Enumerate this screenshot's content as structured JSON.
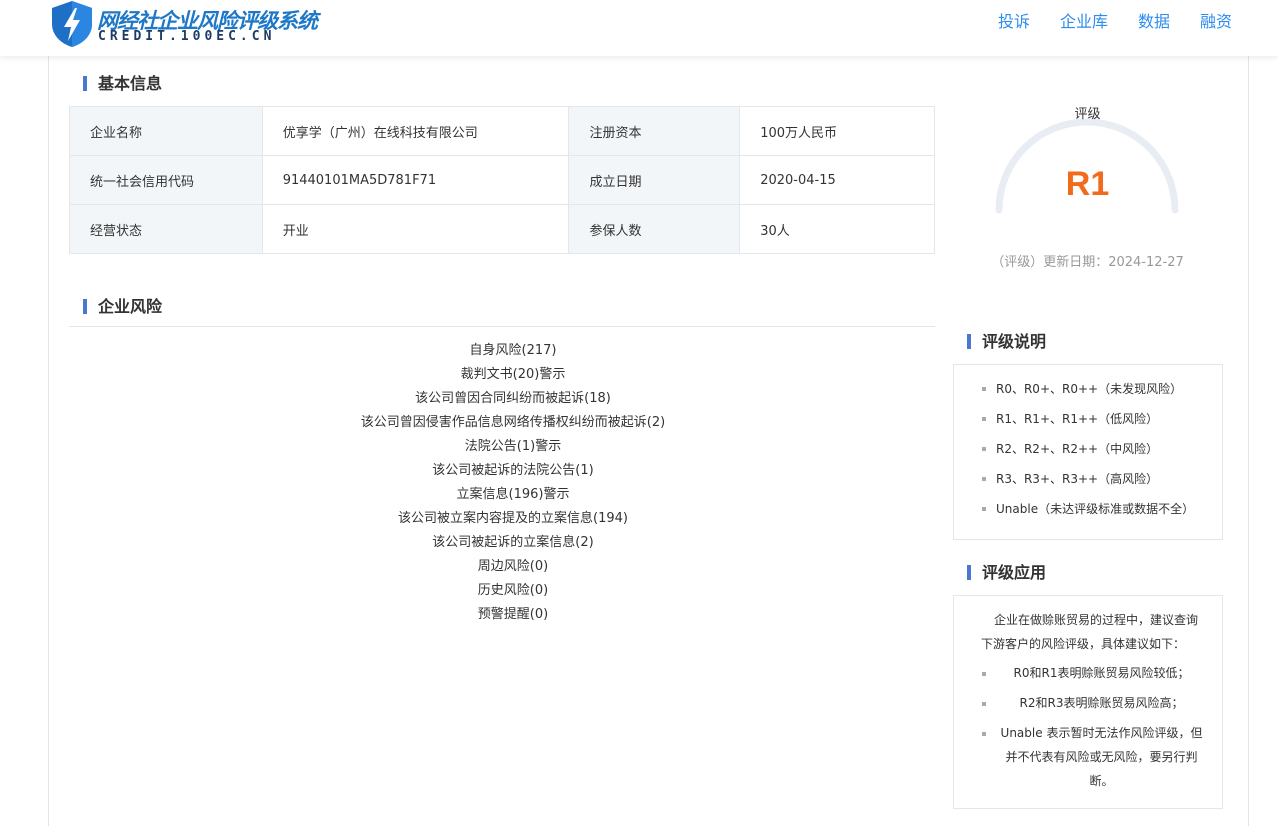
{
  "header": {
    "logo_title": "网经社企业风险评级系统",
    "logo_subtitle": "CREDIT.100EC.CN",
    "nav": [
      "投诉",
      "企业库",
      "数据",
      "融资"
    ]
  },
  "basic_info": {
    "title": "基本信息",
    "rows": [
      [
        "企业名称",
        "优享学（广州）在线科技有限公司",
        "注册资本",
        "100万人民币"
      ],
      [
        "统一社会信用代码",
        "91440101MA5D781F71",
        "成立日期",
        "2020-04-15"
      ],
      [
        "经营状态",
        "开业",
        "参保人数",
        "30人"
      ]
    ]
  },
  "rating": {
    "label": "评级",
    "value": "R1",
    "update_text": "（评级）更新日期：2024-12-27",
    "value_color": "#f26a1b"
  },
  "risk": {
    "title": "企业风险",
    "items": [
      "自身风险(217)",
      "裁判文书(20)警示",
      "该公司曾因合同纠纷而被起诉(18)",
      "该公司曾因侵害作品信息网络传播权纠纷而被起诉(2)",
      "法院公告(1)警示",
      "该公司被起诉的法院公告(1)",
      "立案信息(196)警示",
      "该公司被立案内容提及的立案信息(194)",
      "该公司被起诉的立案信息(2)",
      "周边风险(0)",
      "历史风险(0)",
      "预警提醒(0)"
    ]
  },
  "rating_explanation": {
    "title": "评级说明",
    "items": [
      "R0、R0+、R0++（未发现风险）",
      "R1、R1+、R1++（低风险）",
      "R2、R2+、R2++（中风险）",
      "R3、R3+、R3++（高风险）",
      "Unable（未达评级标准或数据不全）"
    ]
  },
  "rating_application": {
    "title": "评级应用",
    "intro": "企业在做赊账贸易的过程中，建议查询下游客户的风险评级，具体建议如下：",
    "items": [
      "R0和R1表明赊账贸易风险较低；",
      "R2和R3表明赊账贸易风险高；",
      "Unable 表示暂时无法作风险评级，但并不代表有风险或无风险，要另行判断。"
    ]
  },
  "colors": {
    "accent": "#2d8cf0",
    "section_bar": "#4a78d0",
    "gauge_track": "#e8edf4"
  }
}
